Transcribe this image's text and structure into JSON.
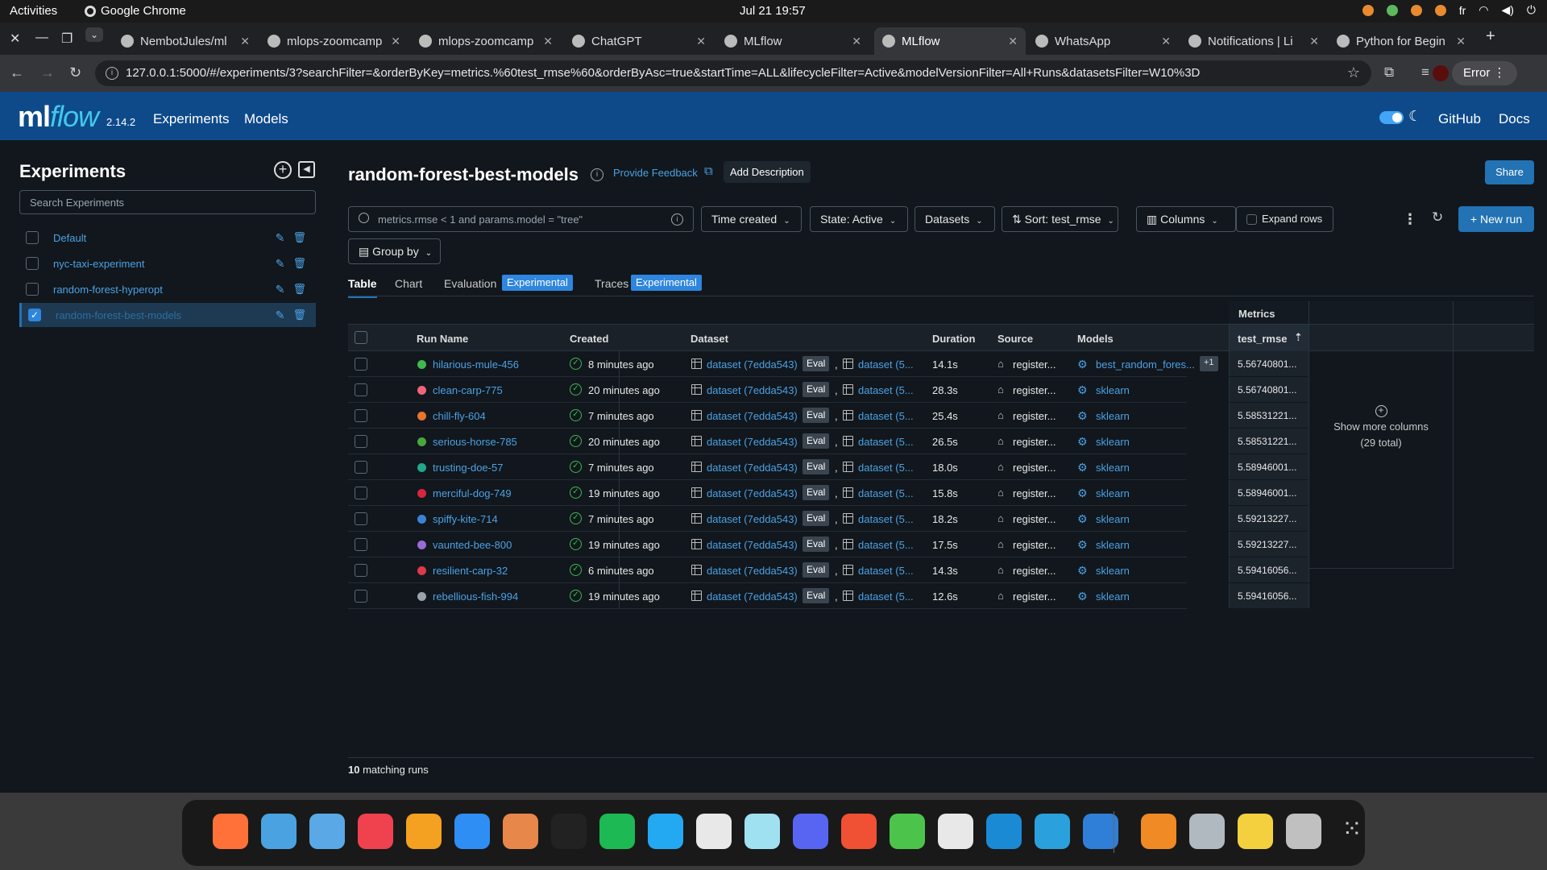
{
  "system": {
    "activities": "Activities",
    "app_name": "Google Chrome",
    "clock": "Jul 21  19:57",
    "lang": "fr"
  },
  "tabs": [
    {
      "title": "NembotJules/ml",
      "icon": "github-icon"
    },
    {
      "title": "mlops-zoomcamp",
      "icon": "github-icon"
    },
    {
      "title": "mlops-zoomcamp",
      "icon": "github-icon"
    },
    {
      "title": "ChatGPT",
      "icon": "chatgpt-icon"
    },
    {
      "title": "MLflow",
      "icon": "mlflow-icon"
    },
    {
      "title": "MLflow",
      "icon": "mlflow-icon"
    },
    {
      "title": "WhatsApp",
      "icon": "whatsapp-icon"
    },
    {
      "title": "Notifications | Li",
      "icon": "linkedin-icon"
    },
    {
      "title": "Python for Begin",
      "icon": "youtube-icon"
    }
  ],
  "address": {
    "url": "127.0.0.1:5000/#/experiments/3?searchFilter=&orderByKey=metrics.%60test_rmse%60&orderByAsc=true&startTime=ALL&lifecycleFilter=Active&modelVersionFilter=All+Runs&datasetsFilter=W10%3D",
    "error_label": "Error"
  },
  "header": {
    "logo_ml": "ml",
    "logo_flow": "flow",
    "version": "2.14.2",
    "nav": [
      "Experiments",
      "Models"
    ],
    "links": [
      "GitHub",
      "Docs"
    ]
  },
  "sidebar": {
    "title": "Experiments",
    "search_placeholder": "Search Experiments",
    "items": [
      {
        "name": "Default",
        "checked": false
      },
      {
        "name": "nyc-taxi-experiment",
        "checked": false
      },
      {
        "name": "random-forest-hyperopt",
        "checked": false
      },
      {
        "name": "random-forest-best-models",
        "checked": true
      }
    ]
  },
  "experiment": {
    "title": "random-forest-best-models",
    "feedback": "Provide Feedback",
    "add_description": "Add Description",
    "share": "Share"
  },
  "filters": {
    "search_placeholder": "metrics.rmse < 1 and params.model = \"tree\"",
    "time_created": "Time created",
    "state": "State: Active",
    "datasets": "Datasets",
    "sort": "Sort: test_rmse",
    "columns": "Columns",
    "expand_rows": "Expand rows",
    "new_run": "New run",
    "group_by": "Group by"
  },
  "view_tabs": {
    "table": "Table",
    "chart": "Chart",
    "evaluation": "Evaluation",
    "traces": "Traces",
    "experimental": "Experimental"
  },
  "table": {
    "metrics_group": "Metrics",
    "headers": {
      "run_name": "Run Name",
      "created": "Created",
      "dataset": "Dataset",
      "duration": "Duration",
      "source": "Source",
      "models": "Models",
      "test_rmse": "test_rmse"
    },
    "rows": [
      {
        "name": "hilarious-mule-456",
        "color": "#3fb950",
        "created": "8 minutes ago",
        "ds1": "dataset (7edda543)",
        "eval": "Eval",
        "ds2": "dataset (5...",
        "duration": "14.1s",
        "source": "register...",
        "model": "best_random_fores...",
        "extra": "+1",
        "rmse": "5.56740801..."
      },
      {
        "name": "clean-carp-775",
        "color": "#f0657a",
        "created": "20 minutes ago",
        "ds1": "dataset (7edda543)",
        "eval": "Eval",
        "ds2": "dataset (5...",
        "duration": "28.3s",
        "source": "register...",
        "model": "sklearn",
        "extra": "",
        "rmse": "5.56740801..."
      },
      {
        "name": "chill-fly-604",
        "color": "#e8742e",
        "created": "7 minutes ago",
        "ds1": "dataset (7edda543)",
        "eval": "Eval",
        "ds2": "dataset (5...",
        "duration": "25.4s",
        "source": "register...",
        "model": "sklearn",
        "extra": "",
        "rmse": "5.58531221..."
      },
      {
        "name": "serious-horse-785",
        "color": "#47a83c",
        "created": "20 minutes ago",
        "ds1": "dataset (7edda543)",
        "eval": "Eval",
        "ds2": "dataset (5...",
        "duration": "26.5s",
        "source": "register...",
        "model": "sklearn",
        "extra": "",
        "rmse": "5.58531221..."
      },
      {
        "name": "trusting-doe-57",
        "color": "#22a88a",
        "created": "7 minutes ago",
        "ds1": "dataset (7edda543)",
        "eval": "Eval",
        "ds2": "dataset (5...",
        "duration": "18.0s",
        "source": "register...",
        "model": "sklearn",
        "extra": "",
        "rmse": "5.58946001..."
      },
      {
        "name": "merciful-dog-749",
        "color": "#d6263e",
        "created": "19 minutes ago",
        "ds1": "dataset (7edda543)",
        "eval": "Eval",
        "ds2": "dataset (5...",
        "duration": "15.8s",
        "source": "register...",
        "model": "sklearn",
        "extra": "",
        "rmse": "5.58946001..."
      },
      {
        "name": "spiffy-kite-714",
        "color": "#3b82d6",
        "created": "7 minutes ago",
        "ds1": "dataset (7edda543)",
        "eval": "Eval",
        "ds2": "dataset (5...",
        "duration": "18.2s",
        "source": "register...",
        "model": "sklearn",
        "extra": "",
        "rmse": "5.59213227..."
      },
      {
        "name": "vaunted-bee-800",
        "color": "#9a6bd6",
        "created": "19 minutes ago",
        "ds1": "dataset (7edda543)",
        "eval": "Eval",
        "ds2": "dataset (5...",
        "duration": "17.5s",
        "source": "register...",
        "model": "sklearn",
        "extra": "",
        "rmse": "5.59213227..."
      },
      {
        "name": "resilient-carp-32",
        "color": "#e0384a",
        "created": "6 minutes ago",
        "ds1": "dataset (7edda543)",
        "eval": "Eval",
        "ds2": "dataset (5...",
        "duration": "14.3s",
        "source": "register...",
        "model": "sklearn",
        "extra": "",
        "rmse": "5.59416056..."
      },
      {
        "name": "rebellious-fish-994",
        "color": "#9aa3ab",
        "created": "19 minutes ago",
        "ds1": "dataset (7edda543)",
        "eval": "Eval",
        "ds2": "dataset (5...",
        "duration": "12.6s",
        "source": "register...",
        "model": "sklearn",
        "extra": "",
        "rmse": "5.59416056..."
      }
    ],
    "show_more": "Show more columns",
    "total_cols": "(29 total)"
  },
  "footer": {
    "count": "10",
    "label": " matching runs"
  },
  "dock": {
    "apps": [
      {
        "name": "firefox-icon",
        "color": "#ff7139"
      },
      {
        "name": "mail-icon",
        "color": "#4aa3e0"
      },
      {
        "name": "finder-icon",
        "color": "#5aa9e6"
      },
      {
        "name": "music-icon",
        "color": "#f0414f"
      },
      {
        "name": "pages-icon",
        "color": "#f4a020"
      },
      {
        "name": "app-store-icon",
        "color": "#2f8ef4"
      },
      {
        "name": "keynote-icon",
        "color": "#e8874a"
      },
      {
        "name": "terminal-icon",
        "color": "#222"
      },
      {
        "name": "spotify-icon",
        "color": "#1db954"
      },
      {
        "name": "vscode-icon",
        "color": "#23a9f2"
      },
      {
        "name": "chrome-icon",
        "color": "#e8e8e8"
      },
      {
        "name": "electron-icon",
        "color": "#9fe1f1"
      },
      {
        "name": "discord-icon",
        "color": "#5865f2"
      },
      {
        "name": "git-gui-icon",
        "color": "#f05033"
      },
      {
        "name": "cloud-download-icon",
        "color": "#4cc44c"
      },
      {
        "name": "slack-icon",
        "color": "#e8e8e8"
      },
      {
        "name": "drawio-icon",
        "color": "#1a8ad4"
      },
      {
        "name": "telegram-icon",
        "color": "#2aa1dc"
      },
      {
        "name": "edge-icon",
        "color": "#2f7ed8"
      },
      {
        "name": "vlc-icon",
        "color": "#f08a24"
      },
      {
        "name": "disk-icon",
        "color": "#b0b8c0"
      },
      {
        "name": "notes-icon",
        "color": "#f4d03f"
      },
      {
        "name": "trash-icon",
        "color": "#c0c0c0"
      },
      {
        "name": "app-grid-icon",
        "color": "#d0d0d0"
      }
    ]
  }
}
